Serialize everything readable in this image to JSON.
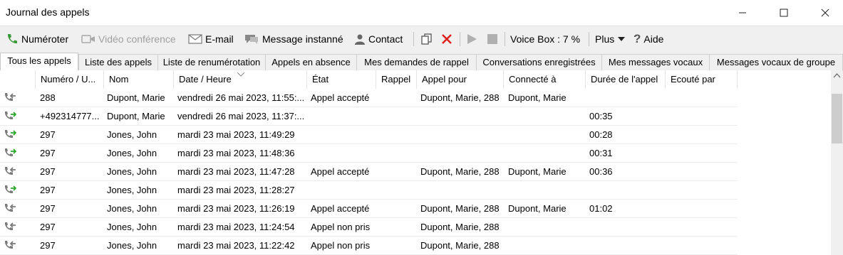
{
  "window": {
    "title": "Journal des appels"
  },
  "toolbar": {
    "dial": "Numéroter",
    "video": "Vidéo conférence",
    "email": "E-mail",
    "im": "Message instanné",
    "contact": "Contact",
    "voicebox": "Voice Box : 7 %",
    "more": "Plus",
    "help": "Aide"
  },
  "tabs": [
    "Tous les appels",
    "Liste des appels",
    "Liste de renumérotation",
    "Appels en absence",
    "Mes demandes de rappel",
    "Conversations enregistrées",
    "Mes messages vocaux",
    "Messages vocaux de groupe"
  ],
  "columns": [
    "Numéro / U...",
    "Nom",
    "Date / Heure",
    "État",
    "Rappel",
    "Appel pour",
    "Connecté à",
    "Durée de l'appel",
    "Ecouté par"
  ],
  "rows": [
    {
      "dir": "incoming",
      "cells": [
        "288",
        "Dupont, Marie",
        "vendredi 26 mai 2023, 11:55:...",
        "Appel accepté",
        "",
        "Dupont, Marie, 288",
        "Dupont, Marie",
        "",
        ""
      ]
    },
    {
      "dir": "outgoing",
      "cells": [
        "+492314777...",
        "Dupont, Marie",
        "vendredi 26 mai 2023, 11:37:...",
        "",
        "",
        "",
        "",
        "00:35",
        ""
      ]
    },
    {
      "dir": "outgoing",
      "cells": [
        "297",
        "Jones, John",
        "mardi 23 mai 2023, 11:49:29",
        "",
        "",
        "",
        "",
        "00:28",
        ""
      ]
    },
    {
      "dir": "outgoing",
      "cells": [
        "297",
        "Jones, John",
        "mardi 23 mai 2023, 11:48:36",
        "",
        "",
        "",
        "",
        "00:31",
        ""
      ]
    },
    {
      "dir": "incoming",
      "cells": [
        "297",
        "Jones, John",
        "mardi 23 mai 2023, 11:47:28",
        "Appel accepté",
        "",
        "Dupont, Marie, 288",
        "Dupont, Marie",
        "00:36",
        ""
      ]
    },
    {
      "dir": "outgoing",
      "cells": [
        "297",
        "Jones, John",
        "mardi 23 mai 2023, 11:28:27",
        "",
        "",
        "",
        "",
        "",
        ""
      ]
    },
    {
      "dir": "incoming",
      "cells": [
        "297",
        "Jones, John",
        "mardi 23 mai 2023, 11:26:19",
        "Appel accepté",
        "",
        "Dupont, Marie, 288",
        "Dupont, Marie",
        "01:02",
        ""
      ]
    },
    {
      "dir": "incoming",
      "cells": [
        "297",
        "Jones, John",
        "mardi 23 mai 2023, 11:24:54",
        "Appel non pris",
        "",
        "Dupont, Marie, 288",
        "",
        "",
        ""
      ]
    },
    {
      "dir": "incoming",
      "cells": [
        "297",
        "Jones, John",
        "mardi 23 mai 2023, 11:22:42",
        "Appel non pris",
        "",
        "Dupont, Marie, 288",
        "",
        "",
        ""
      ]
    }
  ],
  "colors": {
    "incoming": "#7a7a7a",
    "outgoing": "#2ea82e",
    "delete": "#e0201c",
    "phone": "#3a9a3a"
  }
}
